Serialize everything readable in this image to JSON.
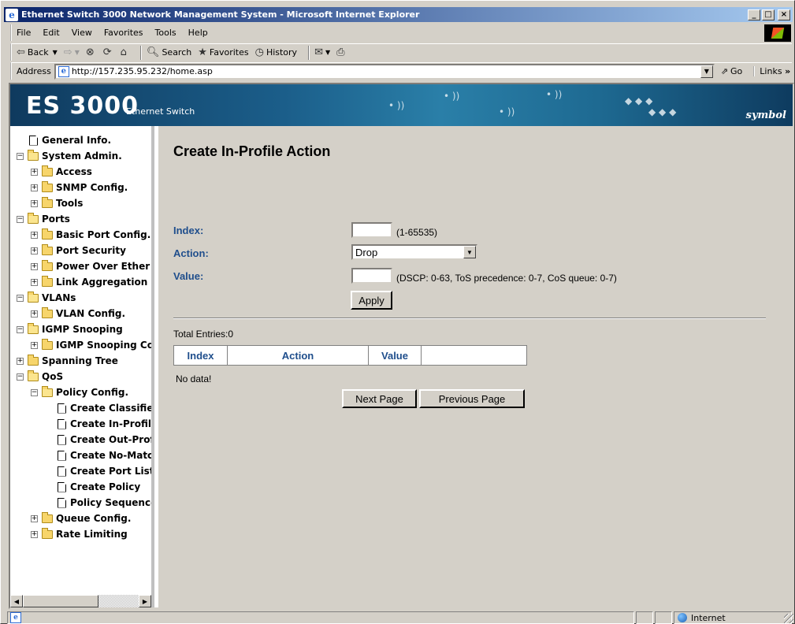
{
  "window": {
    "title": "Ethernet Switch 3000 Network Management System - Microsoft Internet Explorer"
  },
  "menu": {
    "file": "File",
    "edit": "Edit",
    "view": "View",
    "favorites": "Favorites",
    "tools": "Tools",
    "help": "Help"
  },
  "toolbar": {
    "back": "Back",
    "search": "Search",
    "favorites": "Favorites",
    "history": "History"
  },
  "address": {
    "label": "Address",
    "url": "http://157.235.95.232/home.asp",
    "go": "Go",
    "links": "Links"
  },
  "banner": {
    "logo": "ES 3000",
    "subtitle": "Ethernet Switch",
    "brand": "symbol"
  },
  "tree": [
    {
      "label": "General Info.",
      "type": "doc",
      "indent": 0,
      "expander": ""
    },
    {
      "label": "System Admin.",
      "type": "folder-open",
      "indent": 0,
      "expander": "−"
    },
    {
      "label": "Access",
      "type": "folder",
      "indent": 1,
      "expander": "+"
    },
    {
      "label": "SNMP Config.",
      "type": "folder",
      "indent": 1,
      "expander": "+"
    },
    {
      "label": "Tools",
      "type": "folder",
      "indent": 1,
      "expander": "+"
    },
    {
      "label": "Ports",
      "type": "folder-open",
      "indent": 0,
      "expander": "−"
    },
    {
      "label": "Basic Port Config.",
      "type": "folder",
      "indent": 1,
      "expander": "+"
    },
    {
      "label": "Port Security",
      "type": "folder",
      "indent": 1,
      "expander": "+"
    },
    {
      "label": "Power Over Ether",
      "type": "folder",
      "indent": 1,
      "expander": "+"
    },
    {
      "label": "Link Aggregation",
      "type": "folder",
      "indent": 1,
      "expander": "+"
    },
    {
      "label": "VLANs",
      "type": "folder-open",
      "indent": 0,
      "expander": "−"
    },
    {
      "label": "VLAN Config.",
      "type": "folder",
      "indent": 1,
      "expander": "+"
    },
    {
      "label": "IGMP Snooping",
      "type": "folder-open",
      "indent": 0,
      "expander": "−"
    },
    {
      "label": "IGMP Snooping Co",
      "type": "folder",
      "indent": 1,
      "expander": "+"
    },
    {
      "label": "Spanning Tree",
      "type": "folder",
      "indent": 0,
      "expander": "+"
    },
    {
      "label": "QoS",
      "type": "folder-open",
      "indent": 0,
      "expander": "−"
    },
    {
      "label": "Policy Config.",
      "type": "folder-open",
      "indent": 1,
      "expander": "−"
    },
    {
      "label": "Create Classifie",
      "type": "doc",
      "indent": 2,
      "expander": ""
    },
    {
      "label": "Create In-Profil",
      "type": "doc",
      "indent": 2,
      "expander": ""
    },
    {
      "label": "Create Out-Prof",
      "type": "doc",
      "indent": 2,
      "expander": ""
    },
    {
      "label": "Create No-Matc",
      "type": "doc",
      "indent": 2,
      "expander": ""
    },
    {
      "label": "Create Port List",
      "type": "doc",
      "indent": 2,
      "expander": ""
    },
    {
      "label": "Create Policy",
      "type": "doc",
      "indent": 2,
      "expander": ""
    },
    {
      "label": "Policy Sequence",
      "type": "doc",
      "indent": 2,
      "expander": ""
    },
    {
      "label": "Queue Config.",
      "type": "folder",
      "indent": 1,
      "expander": "+"
    },
    {
      "label": "Rate Limiting",
      "type": "folder",
      "indent": 1,
      "expander": "+"
    }
  ],
  "form": {
    "title": "Create In-Profile Action",
    "index_label": "Index:",
    "index_value": "",
    "index_hint": "(1-65535)",
    "action_label": "Action:",
    "action_value": "Drop",
    "value_label": "Value:",
    "value_value": "",
    "value_hint": "(DSCP: 0-63, ToS precedence: 0-7, CoS queue: 0-7)",
    "apply": "Apply"
  },
  "results": {
    "total": "Total Entries:0",
    "columns": [
      "Index",
      "Action",
      "Value",
      ""
    ],
    "empty": "No data!",
    "next": "Next Page",
    "previous": "Previous Page"
  },
  "status": {
    "zone": "Internet"
  }
}
